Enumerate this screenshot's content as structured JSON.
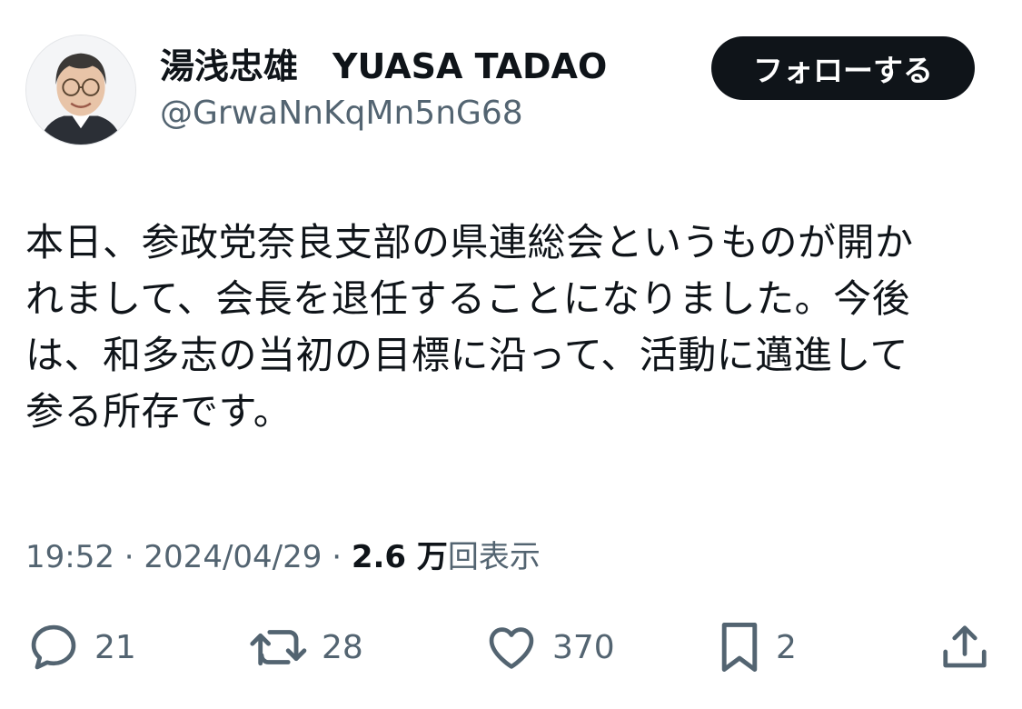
{
  "user": {
    "display_name": "湯浅忠雄　YUASA TADAO",
    "handle": "@GrwaNnKqMn5nG68"
  },
  "follow_button": {
    "label": "フォローする"
  },
  "tweet": {
    "lines": [
      "本日、参政党奈良支部の県連総会というものが開か",
      "れまして、会長を退任することになりました。今後",
      "は、和多志の当初の目標に沿って、活動に邁進して",
      "参る所存です。"
    ]
  },
  "meta": {
    "time": "19:52",
    "separator": "·",
    "date": "2024/04/29",
    "views_count": "2.6 万",
    "views_label": "回表示"
  },
  "actions": {
    "reply": {
      "icon": "reply-icon",
      "count": "21"
    },
    "retweet": {
      "icon": "retweet-icon",
      "count": "28"
    },
    "like": {
      "icon": "heart-icon",
      "count": "370"
    },
    "bookmark": {
      "icon": "bookmark-icon",
      "count": "2"
    },
    "share": {
      "icon": "share-icon"
    }
  },
  "colors": {
    "text_primary": "#0f1419",
    "text_secondary": "#536471",
    "follow_bg": "#0f1419",
    "follow_text": "#ffffff"
  }
}
